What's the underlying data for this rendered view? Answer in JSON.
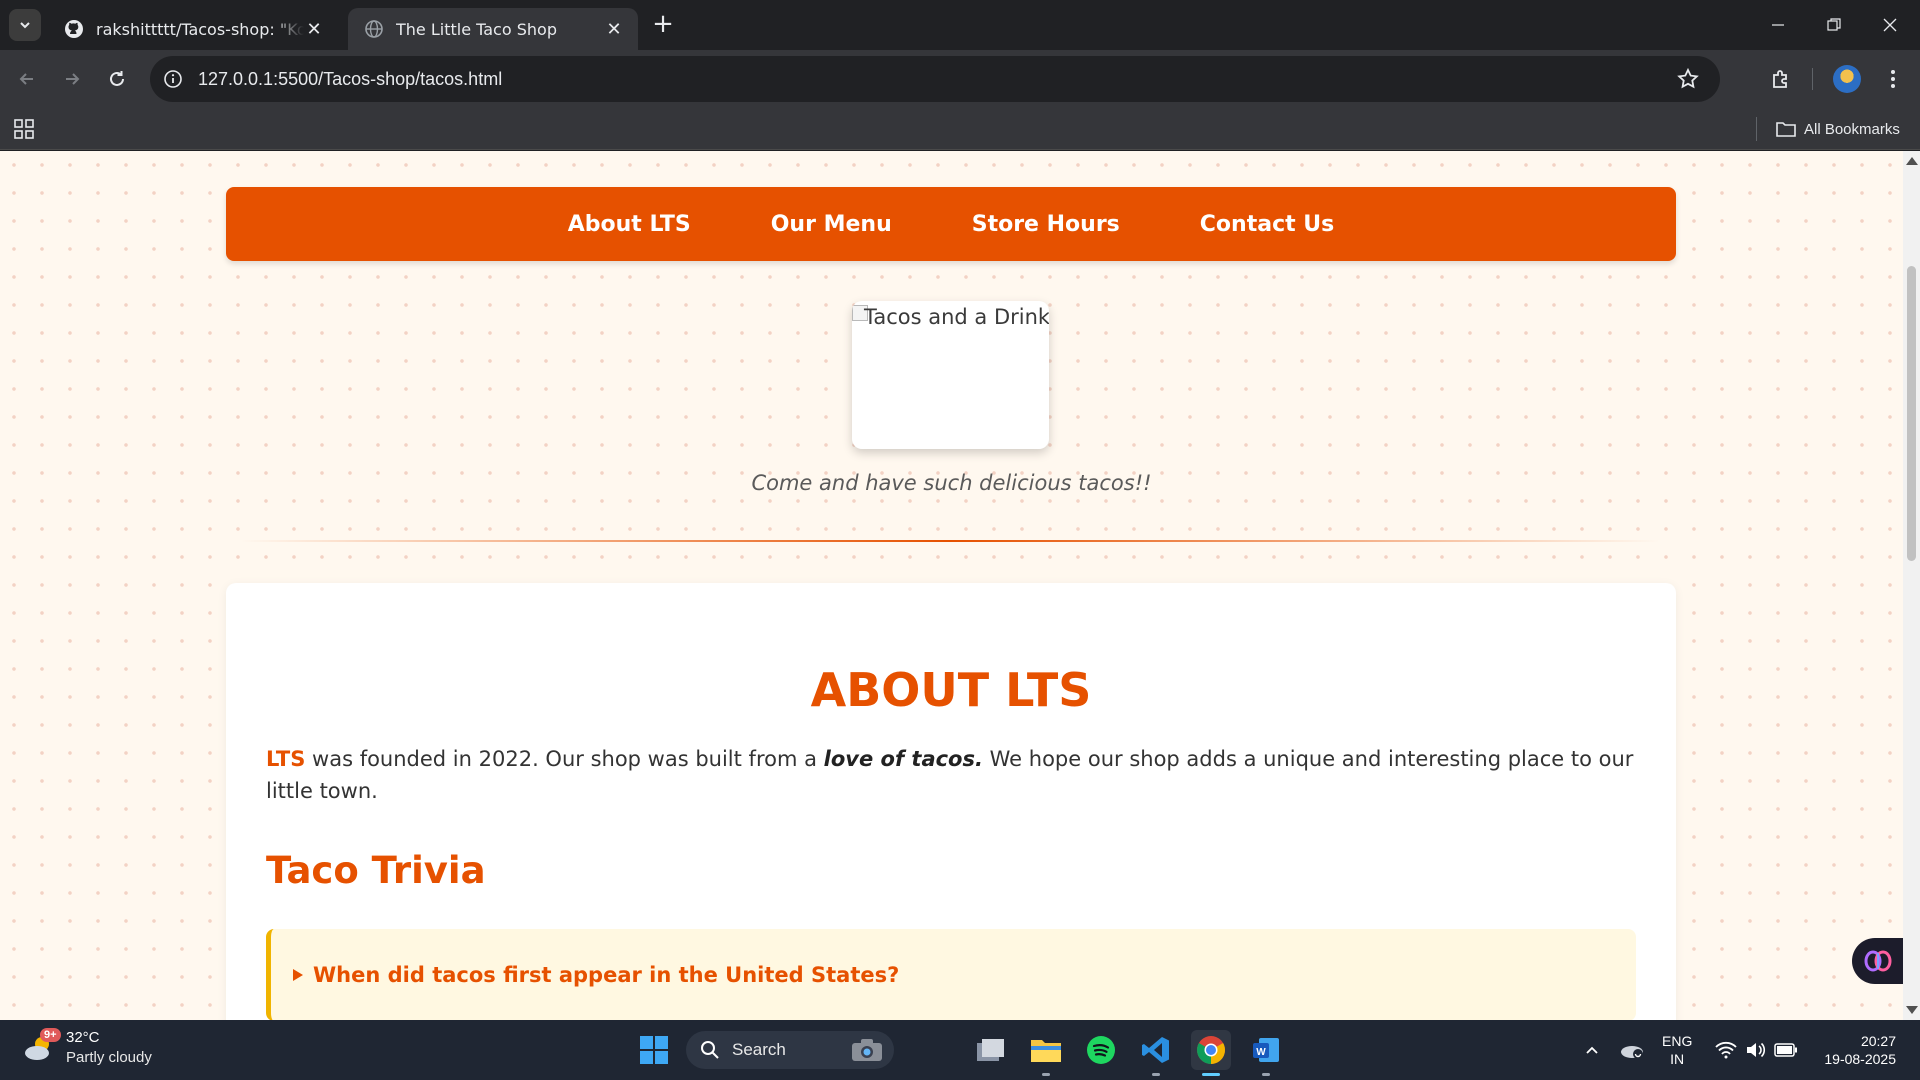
{
  "browser": {
    "tabs": [
      {
        "title": "rakshittttt/Tacos-shop: \"Kon hai",
        "favicon": "github-icon",
        "active": false
      },
      {
        "title": "The Little Taco Shop",
        "favicon": "globe-icon",
        "active": true
      }
    ],
    "url": "127.0.0.1:5500/Tacos-shop/tacos.html",
    "bookmarks_label": "All Bookmarks"
  },
  "page": {
    "nav": [
      "About LTS",
      "Our Menu",
      "Store Hours",
      "Contact Us"
    ],
    "hero_alt": "Tacos and a Drink",
    "caption": "Come and have such delicious tacos!!",
    "about": {
      "heading": "ABOUT LTS",
      "brand": "LTS",
      "text_before": " was founded in 2022. Our shop was built from a ",
      "emphasis": "love of tacos.",
      "text_after": " We hope our shop adds a unique and interesting place to our little town."
    },
    "trivia": {
      "heading": "Taco Trivia",
      "question": "When did tacos first appear in the United States?"
    }
  },
  "taskbar": {
    "weather_temp": "32°C",
    "weather_cond": "Partly cloudy",
    "weather_badge": "9+",
    "search_label": "Search",
    "lang_1": "ENG",
    "lang_2": "IN",
    "time": "20:27",
    "date": "19-08-2025"
  },
  "colors": {
    "brand_orange": "#e65100",
    "page_bg": "#fff8ef",
    "trivia_bg": "#fff8e1",
    "trivia_border": "#f0b400"
  }
}
